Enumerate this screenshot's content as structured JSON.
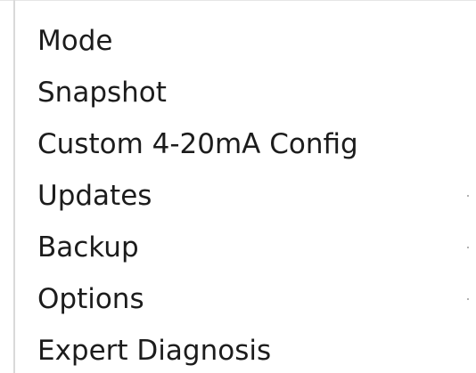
{
  "menu": {
    "items": [
      {
        "label": "Mode",
        "has_submenu": false
      },
      {
        "label": "Snapshot",
        "has_submenu": false
      },
      {
        "label": "Custom 4-20mA Config",
        "has_submenu": false
      },
      {
        "label": "Updates",
        "has_submenu": true
      },
      {
        "label": "Backup",
        "has_submenu": true
      },
      {
        "label": "Options",
        "has_submenu": true
      },
      {
        "label": "Expert Diagnosis",
        "has_submenu": false
      }
    ]
  },
  "icons": {
    "submenu_indicator": "chevron-right-icon"
  },
  "colors": {
    "background": "#ffffff",
    "text": "#1c1c1c",
    "edge": "#d9d9d9"
  }
}
